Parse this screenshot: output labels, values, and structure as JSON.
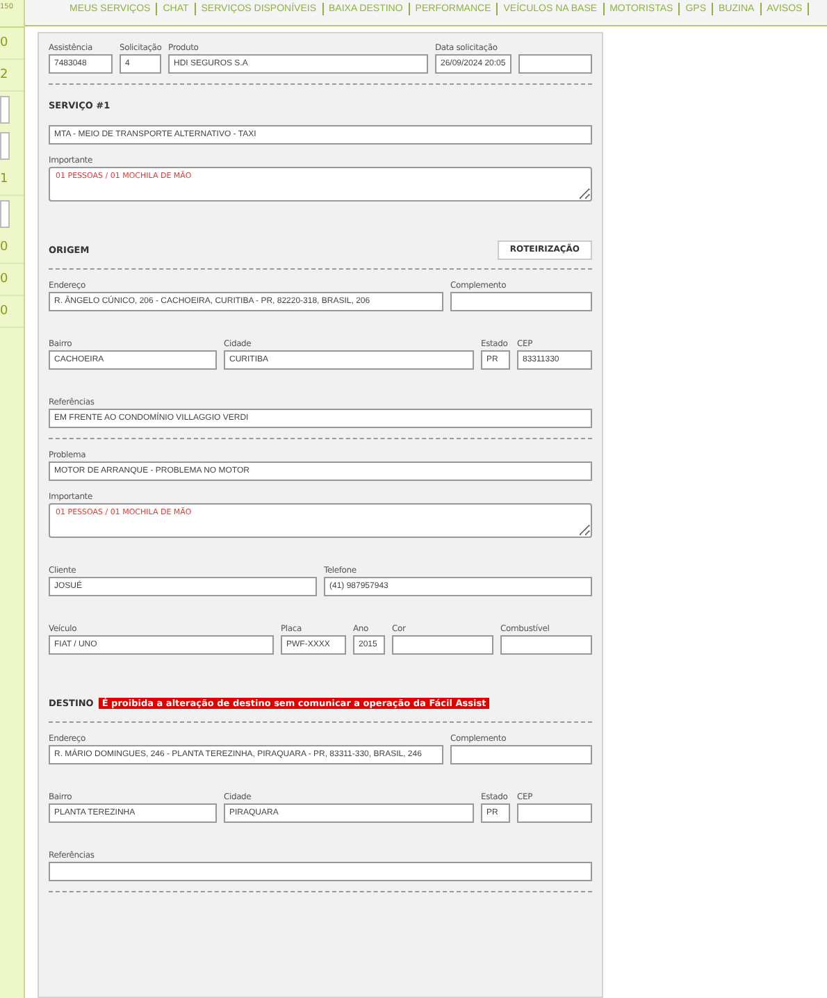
{
  "nav": {
    "items": [
      "MEUS SERVIÇOS",
      "CHAT",
      "SERVIÇOS DISPONÍVEIS",
      "BAIXA DESTINO",
      "PERFORMANCE",
      "VEÍCULOS NA BASE",
      "MOTORISTAS",
      "GPS",
      "BUZINA",
      "AVISOS"
    ]
  },
  "sidebar": {
    "items": [
      {
        "kind": "caption",
        "text": "150"
      },
      {
        "kind": "count",
        "text": "0"
      },
      {
        "kind": "count",
        "text": "2"
      },
      {
        "kind": "box"
      },
      {
        "kind": "box"
      },
      {
        "kind": "count",
        "text": "1"
      },
      {
        "kind": "box"
      },
      {
        "kind": "count",
        "text": "0"
      },
      {
        "kind": "count",
        "text": "0"
      },
      {
        "kind": "count",
        "text": "0"
      }
    ]
  },
  "form": {
    "blocks": [
      {
        "kind": "request",
        "fields": [
          {
            "label": "Assistência",
            "value": "7483048"
          },
          {
            "label": "Solicitação",
            "value": "4"
          },
          {
            "label": "Produto",
            "value": "HDI SEGUROS S.A"
          },
          {
            "label": "Data solicitação",
            "value": "26/09/2024 20:05"
          }
        ]
      },
      {
        "kind": "divider"
      },
      {
        "kind": "heading",
        "title": "SERVIÇO #1"
      },
      {
        "kind": "single",
        "fields": [
          {
            "value": "MTA - MEIO DE TRANSPORTE ALTERNATIVO - TAXI"
          }
        ]
      },
      {
        "kind": "note",
        "label": "Importante",
        "value": "01 PESSOAS / 01 MOCHILA DE MÃO",
        "alert": true
      },
      {
        "kind": "heading",
        "title": "ORIGEM",
        "button": "ROTEIRIZAÇÃO"
      },
      {
        "kind": "divider"
      },
      {
        "kind": "address",
        "fields": [
          {
            "label": "Endereço",
            "value": "R. ÂNGELO CÚNICO, 206 - CACHOEIRA, CURITIBA - PR, 82220-318, BRASIL, 206"
          },
          {
            "label": "Complemento"
          }
        ]
      },
      {
        "kind": "district",
        "fields": [
          {
            "label": "Bairro",
            "value": "CACHOEIRA"
          },
          {
            "label": "Cidade",
            "value": "CURITIBA"
          },
          {
            "label": "Estado",
            "value": "PR"
          },
          {
            "label": "CEP",
            "value": "83311330"
          }
        ]
      },
      {
        "kind": "single",
        "fields": [
          {
            "label": "Referências",
            "value": "EM FRENTE AO CONDOMÍNIO VILLAGGIO VERDI"
          }
        ]
      },
      {
        "kind": "divider"
      },
      {
        "kind": "single",
        "fields": [
          {
            "label": "Problema",
            "value": "MOTOR DE ARRANQUE - PROBLEMA NO MOTOR"
          }
        ]
      },
      {
        "kind": "note",
        "label": "Importante",
        "value": "01 PESSOAS / 01 MOCHILA DE MÃO",
        "alert": true
      },
      {
        "kind": "client",
        "fields": [
          {
            "label": "Cliente",
            "value": "JOSUÉ"
          },
          {
            "label": "Telefone",
            "value": "(41) 987957943"
          }
        ]
      },
      {
        "kind": "vehicle",
        "fields": [
          {
            "label": "Veículo",
            "value": "FIAT / UNO"
          },
          {
            "label": "Placa",
            "value": "PWF-XXXX"
          },
          {
            "label": "Ano",
            "value": "2015"
          },
          {
            "label": "Cor"
          },
          {
            "label": "Combustível"
          }
        ]
      },
      {
        "kind": "heading",
        "title": "DESTINO",
        "warning": "É proibida a alteração de destino sem comunicar a operação da Fácil Assist"
      },
      {
        "kind": "divider"
      },
      {
        "kind": "address",
        "fields": [
          {
            "label": "Endereço",
            "value": "R. MÁRIO DOMINGUES, 246 - PLANTA TEREZINHA, PIRAQUARA - PR, 83311-330, BRASIL, 246"
          },
          {
            "label": "Complemento"
          }
        ]
      },
      {
        "kind": "district",
        "fields": [
          {
            "label": "Bairro",
            "value": "PLANTA TEREZINHA"
          },
          {
            "label": "Cidade",
            "value": "PIRAQUARA"
          },
          {
            "label": "Estado",
            "value": "PR"
          },
          {
            "label": "CEP"
          }
        ]
      },
      {
        "kind": "single",
        "fields": [
          {
            "label": "Referências"
          }
        ]
      },
      {
        "kind": "divider"
      }
    ]
  }
}
